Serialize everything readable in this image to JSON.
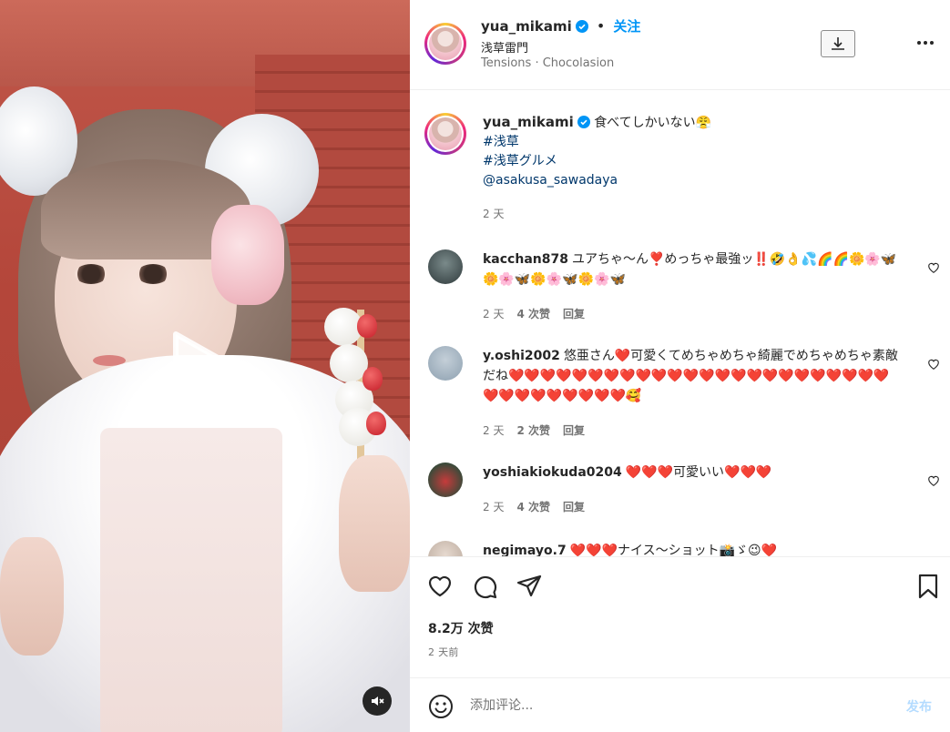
{
  "header": {
    "username": "yua_mikami",
    "separator": "•",
    "follow_label": "关注",
    "location": "浅草雷門",
    "audio": "Tensions · Chocolasion"
  },
  "caption": {
    "username": "yua_mikami",
    "text": "食べてしかいない😤",
    "tags": [
      "#浅草",
      "#浅草グルメ",
      "@asakusa_sawadaya"
    ],
    "time": "2 天"
  },
  "comments": [
    {
      "username": "kacchan878",
      "text": "ユアちゃ～ん❣️めっちゃ最強ッ‼️🤣👌💦🌈🌈🌼🌸🦋🌼🌸🦋🌼🌸🦋🌼🌸🦋",
      "time": "2 天",
      "likes": "4 次赞",
      "reply": "回复"
    },
    {
      "username": "y.oshi2002",
      "text": "悠亜さん❤️可愛くてめちゃめちゃ綺麗でめちゃめちゃ素敵だね❤️❤️❤️❤️❤️❤️❤️❤️❤️❤️❤️❤️❤️❤️❤️❤️❤️❤️❤️❤️❤️❤️❤️❤️❤️❤️❤️❤️❤️❤️❤️❤️❤️🥰",
      "time": "2 天",
      "likes": "2 次赞",
      "reply": "回复"
    },
    {
      "username": "yoshiakiokuda0204",
      "text": "❤️❤️❤️可愛いい❤️❤️❤️",
      "time": "2 天",
      "likes": "4 次赞",
      "reply": "回复"
    },
    {
      "username": "negimayo.7",
      "text": "❤️❤️❤️ナイス〜ショット📸ゞ😉❤️",
      "time": "",
      "likes": "",
      "reply": ""
    }
  ],
  "actions": {
    "likes": "8.2万 次赞",
    "ago": "2 天前"
  },
  "add_comment": {
    "placeholder": "添加评论...",
    "post_label": "发布"
  },
  "icons": {
    "verified": "verified-badge-icon",
    "download": "download-icon",
    "more": "more-icon",
    "like": "heart-icon",
    "comment": "comment-icon",
    "share": "share-icon",
    "save": "bookmark-icon",
    "emoji": "emoji-icon",
    "play": "play-icon",
    "mute": "muted-icon"
  },
  "colors": {
    "accent": "#0095f6",
    "link": "#00376b",
    "heart": "#ed4956",
    "post_disabled": "#b3dbff"
  }
}
